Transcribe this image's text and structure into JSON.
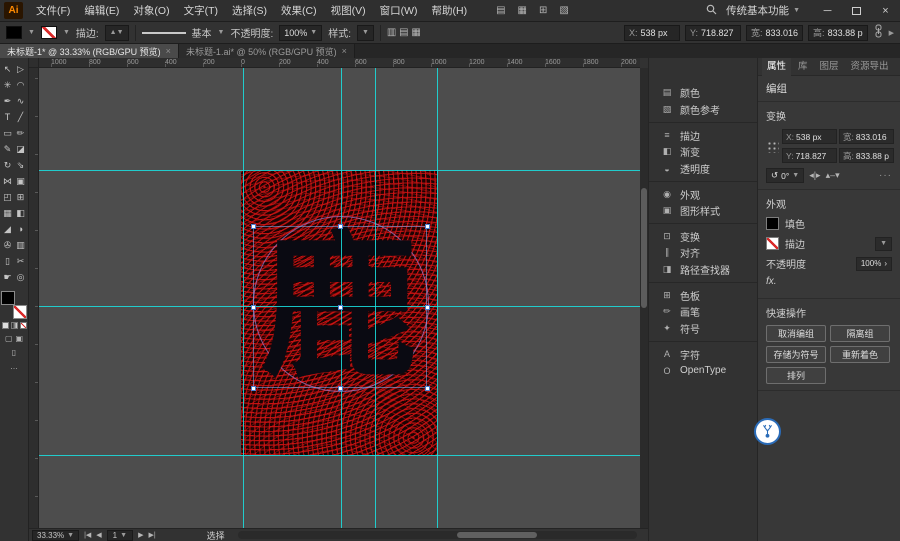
{
  "titlebar": {
    "logo": "Ai",
    "menus": [
      "文件(F)",
      "编辑(E)",
      "对象(O)",
      "文字(T)",
      "选择(S)",
      "效果(C)",
      "视图(V)",
      "窗口(W)",
      "帮助(H)"
    ],
    "quick_icons": [
      {
        "name": "bridge-icon",
        "glyph": "▤"
      },
      {
        "name": "stock-icon",
        "glyph": "▦"
      },
      {
        "name": "arrange-documents-icon",
        "glyph": "⊞"
      },
      {
        "name": "document-setup-icon",
        "glyph": "▧"
      }
    ],
    "workspace": "传统基本功能",
    "minimize_glyph": "─",
    "close_glyph": "×"
  },
  "controlbar": {
    "stroke_label": "描边:",
    "brush_style": "基本",
    "opacity_label": "不透明度:",
    "opacity_value": "100%",
    "style_label": "样式:",
    "fields": [
      {
        "label": "X:",
        "value": "538 px"
      },
      {
        "label": "Y:",
        "value": "718.827"
      },
      {
        "label": "宽:",
        "value": "833.016"
      },
      {
        "label": "高:",
        "value": "833.88 p"
      }
    ]
  },
  "tabs": {
    "doc1": {
      "label": "未标题-1* @ 33.33% (RGB/GPU 预览)",
      "close": "×"
    },
    "doc2": {
      "label": "未标题-1.ai* @ 50% (RGB/GPU 预览)",
      "close": "×"
    }
  },
  "tools": [
    {
      "name": "selection-tool",
      "glyph": "↖"
    },
    {
      "name": "direct-selection-tool",
      "glyph": "▷"
    },
    {
      "name": "magic-wand-tool",
      "glyph": "✳"
    },
    {
      "name": "lasso-tool",
      "glyph": "◠"
    },
    {
      "name": "pen-tool",
      "glyph": "✒"
    },
    {
      "name": "curvature-tool",
      "glyph": "∿"
    },
    {
      "name": "type-tool",
      "glyph": "T"
    },
    {
      "name": "line-segment-tool",
      "glyph": "╱"
    },
    {
      "name": "rectangle-tool",
      "glyph": "▭"
    },
    {
      "name": "paintbrush-tool",
      "glyph": "✏"
    },
    {
      "name": "pencil-tool",
      "glyph": "✎"
    },
    {
      "name": "eraser-tool",
      "glyph": "◪"
    },
    {
      "name": "rotate-tool",
      "glyph": "↻"
    },
    {
      "name": "scale-tool",
      "glyph": "⇘"
    },
    {
      "name": "width-tool",
      "glyph": "⋈"
    },
    {
      "name": "free-transform-tool",
      "glyph": "▣"
    },
    {
      "name": "shape-builder-tool",
      "glyph": "◰"
    },
    {
      "name": "perspective-grid-tool",
      "glyph": "⊞"
    },
    {
      "name": "mesh-tool",
      "glyph": "▦"
    },
    {
      "name": "gradient-tool",
      "glyph": "◧"
    },
    {
      "name": "eyedropper-tool",
      "glyph": "◢"
    },
    {
      "name": "blend-tool",
      "glyph": "◑"
    },
    {
      "name": "symbol-sprayer-tool",
      "glyph": "✇"
    },
    {
      "name": "column-graph-tool",
      "glyph": "▥"
    },
    {
      "name": "artboard-tool",
      "glyph": "▯"
    },
    {
      "name": "slice-tool",
      "glyph": "✂"
    },
    {
      "name": "hand-tool",
      "glyph": "☛"
    },
    {
      "name": "zoom-tool",
      "glyph": "◎"
    }
  ],
  "rulers": {
    "h": [
      "1000",
      "800",
      "600",
      "400",
      "200",
      "0",
      "200",
      "400",
      "600",
      "800",
      "1000",
      "1200",
      "1400",
      "1600",
      "1800",
      "2000"
    ],
    "v": [
      "400",
      "200",
      "0",
      "200",
      "400",
      "600",
      "800",
      "1000",
      "1200",
      "1400",
      "1600"
    ]
  },
  "canvas": {
    "character": "鹿"
  },
  "dock": {
    "items": [
      {
        "name": "panel-item-color",
        "icon": "▤",
        "label": "颜色"
      },
      {
        "name": "panel-item-color-guide",
        "icon": "▧",
        "label": "颜色参考"
      },
      {
        "name": "panel-item-stroke",
        "icon": "≡",
        "label": "描边"
      },
      {
        "name": "panel-item-gradient",
        "icon": "◧",
        "label": "渐变"
      },
      {
        "name": "panel-item-transparency",
        "icon": "◒",
        "label": "透明度"
      },
      {
        "name": "panel-item-appearance",
        "icon": "◉",
        "label": "外观"
      },
      {
        "name": "panel-item-graphic-styles",
        "icon": "▣",
        "label": "图形样式"
      },
      {
        "name": "panel-item-transform",
        "icon": "⊡",
        "label": "变换"
      },
      {
        "name": "panel-item-align",
        "icon": "∥",
        "label": "对齐"
      },
      {
        "name": "panel-item-pathfinder",
        "icon": "◨",
        "label": "路径查找器"
      },
      {
        "name": "panel-item-swatches",
        "icon": "⊞",
        "label": "色板"
      },
      {
        "name": "panel-item-brushes",
        "icon": "✏",
        "label": "画笔"
      },
      {
        "name": "panel-item-symbols",
        "icon": "✦",
        "label": "符号"
      },
      {
        "name": "panel-item-character",
        "icon": "A",
        "label": "字符"
      },
      {
        "name": "panel-item-opentype",
        "icon": "O",
        "label": "OpenType"
      }
    ]
  },
  "props": {
    "tabs": {
      "properties": "属性",
      "libraries": "库",
      "layers": "图层",
      "export": "资源导出"
    },
    "selection_type": "编组",
    "transform": {
      "title": "变换",
      "fields": [
        {
          "label": "X:",
          "value": "538 px"
        },
        {
          "label": "宽:",
          "value": "833.016"
        },
        {
          "label": "Y:",
          "value": "718.827"
        },
        {
          "label": "高:",
          "value": "833.88 p"
        }
      ],
      "rotate": "0°",
      "more": "···"
    },
    "appearance": {
      "title": "外观",
      "fill_label": "填色",
      "stroke_label": "描边",
      "opacity_label": "不透明度",
      "opacity_value": "100%",
      "fx": "fx."
    },
    "quick": {
      "title": "快速操作",
      "buttons": [
        "取消编组",
        "隔离组",
        "存储为符号",
        "重新着色",
        "排列"
      ]
    }
  },
  "statusbar": {
    "zoom": "33.33%",
    "artboard": "1",
    "tool_hint": "选择"
  },
  "colors": {
    "guide_cyan": "#1ae3e3",
    "pattern_red": "#d01313",
    "pattern_dark": "#1c0303",
    "selection_blue": "#7aa7e8",
    "path_purple": "#9b7fd4",
    "ui_panel": "#323232",
    "ui_canvas": "#4d4d4d",
    "logo_orange": "#ff8a00"
  }
}
